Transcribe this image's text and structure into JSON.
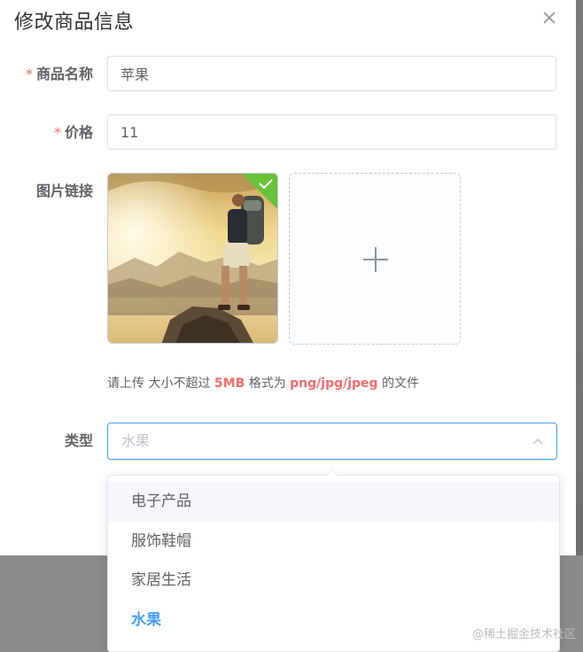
{
  "dialog": {
    "title": "修改商品信息",
    "close_icon": "close-icon"
  },
  "form": {
    "name": {
      "required_mark": "*",
      "label": "商品名称",
      "value": "苹果"
    },
    "price": {
      "required_mark": "*",
      "label": "价格",
      "value": "11"
    },
    "image": {
      "label": "图片链接",
      "success_icon": "check-icon",
      "add_icon": "plus-icon"
    },
    "hint": {
      "prefix": "请上传 大小不超过 ",
      "size": "5MB",
      "middle": " 格式为 ",
      "formats": "png/jpg/jpeg",
      "suffix": " 的文件"
    },
    "type": {
      "label": "类型",
      "placeholder": "水果",
      "arrow_icon": "chevron-up-icon",
      "options": [
        "电子产品",
        "服饰鞋帽",
        "家居生活",
        "水果"
      ],
      "hovered_index": 0,
      "selected_index": 3
    }
  },
  "colors": {
    "accent": "#409eff",
    "required": "#f56c6c",
    "success": "#67c23a"
  },
  "watermark": "@稀土掘金技术社区"
}
